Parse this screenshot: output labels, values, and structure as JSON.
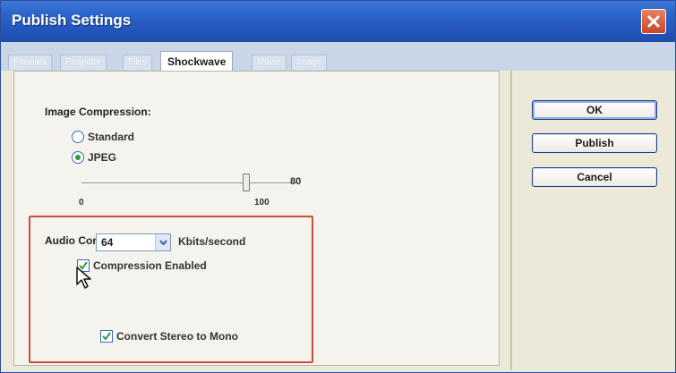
{
  "window": {
    "title": "Publish Settings"
  },
  "tabs": [
    {
      "label": "Formats",
      "active": false
    },
    {
      "label": "Projector",
      "active": false
    },
    {
      "label": "Files",
      "active": false
    },
    {
      "label": "Shockwave",
      "active": true
    },
    {
      "label": "Movie",
      "active": false
    },
    {
      "label": "Image",
      "active": false
    }
  ],
  "image_compression": {
    "label": "Image Compression:",
    "options": [
      {
        "label": "Standard",
        "selected": false
      },
      {
        "label": "JPEG",
        "selected": true
      }
    ],
    "slider": {
      "value": "80",
      "level": 0.8,
      "min_label": "0",
      "max_label": "100"
    }
  },
  "audio_compression": {
    "label": "Audio Compression:",
    "compression_enabled": {
      "label": "Compression Enabled",
      "checked": true
    },
    "bitrate": {
      "value": "64",
      "unit": "Kbits/second"
    },
    "convert_stereo": {
      "label": "Convert Stereo to Mono",
      "checked": true
    }
  },
  "buttons": {
    "ok": "OK",
    "publish": "Publish",
    "cancel": "Cancel"
  },
  "colors": {
    "title_bar": "#2456bd",
    "highlight_box": "#c8503a",
    "checkmark": "#2e9a3a"
  },
  "icons": {
    "close": "close-icon",
    "dropdown": "chevron-down-icon",
    "cursor": "mouse-pointer-icon"
  }
}
